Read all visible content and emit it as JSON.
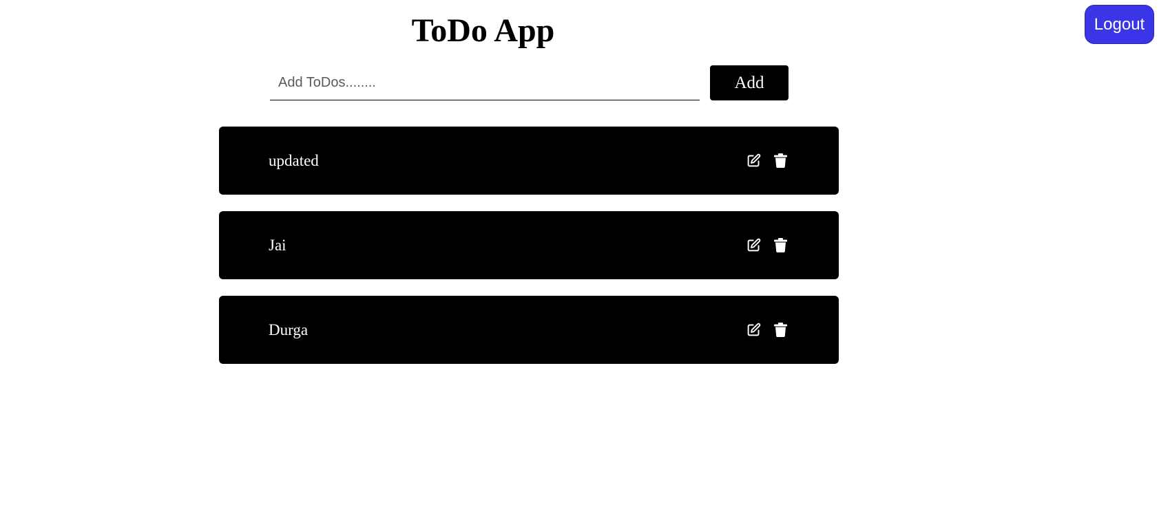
{
  "header": {
    "title": "ToDo App",
    "logout_label": "Logout"
  },
  "form": {
    "input_placeholder": "Add ToDos........",
    "input_value": "",
    "add_label": "Add"
  },
  "todos": [
    {
      "text": "updated",
      "edit_icon": "edit-icon",
      "delete_icon": "trash-icon"
    },
    {
      "text": "Jai",
      "edit_icon": "edit-icon",
      "delete_icon": "trash-icon"
    },
    {
      "text": "Durga",
      "edit_icon": "edit-icon",
      "delete_icon": "trash-icon"
    }
  ],
  "colors": {
    "logout_bg": "#3b35e8",
    "card_bg": "#000000",
    "button_bg": "#000000",
    "text_on_dark": "#ffffff"
  }
}
